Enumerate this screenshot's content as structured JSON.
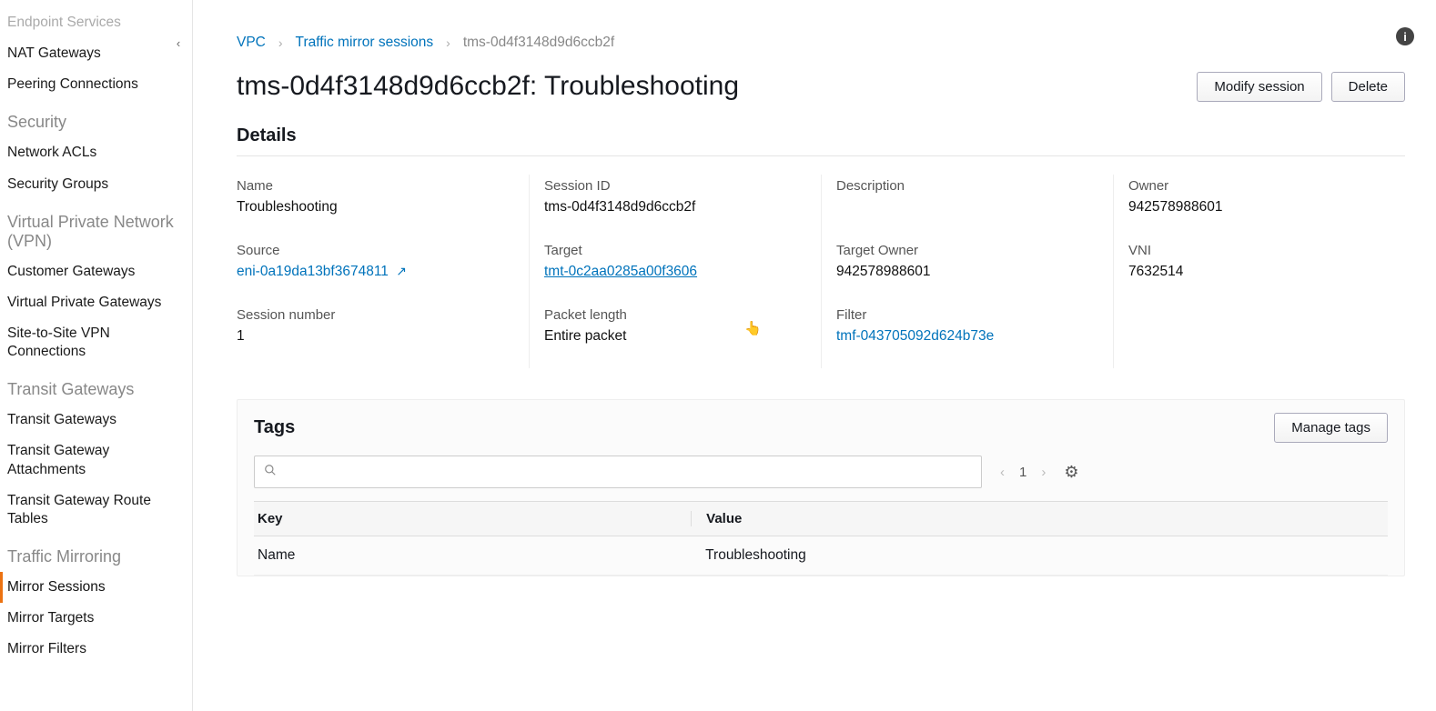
{
  "sidebar": {
    "items": [
      {
        "label": "Endpoint Services",
        "type": "item",
        "cut": true
      },
      {
        "label": "NAT Gateways",
        "type": "item"
      },
      {
        "label": "Peering Connections",
        "type": "item"
      },
      {
        "label": "Security",
        "type": "heading"
      },
      {
        "label": "Network ACLs",
        "type": "item"
      },
      {
        "label": "Security Groups",
        "type": "item"
      },
      {
        "label": "Virtual Private Network (VPN)",
        "type": "heading"
      },
      {
        "label": "Customer Gateways",
        "type": "item"
      },
      {
        "label": "Virtual Private Gateways",
        "type": "item"
      },
      {
        "label": "Site-to-Site VPN Connections",
        "type": "item"
      },
      {
        "label": "Transit Gateways",
        "type": "heading"
      },
      {
        "label": "Transit Gateways",
        "type": "item"
      },
      {
        "label": "Transit Gateway Attachments",
        "type": "item"
      },
      {
        "label": "Transit Gateway Route Tables",
        "type": "item"
      },
      {
        "label": "Traffic Mirroring",
        "type": "heading"
      },
      {
        "label": "Mirror Sessions",
        "type": "item",
        "active": true
      },
      {
        "label": "Mirror Targets",
        "type": "item"
      },
      {
        "label": "Mirror Filters",
        "type": "item"
      }
    ]
  },
  "breadcrumbs": {
    "root": "VPC",
    "mid": "Traffic mirror sessions",
    "current": "tms-0d4f3148d9d6ccb2f"
  },
  "page": {
    "title": "tms-0d4f3148d9d6ccb2f: Troubleshooting",
    "modify_label": "Modify session",
    "delete_label": "Delete"
  },
  "details": {
    "title": "Details",
    "row1": {
      "name_label": "Name",
      "name_value": "Troubleshooting",
      "session_id_label": "Session ID",
      "session_id_value": "tms-0d4f3148d9d6ccb2f",
      "description_label": "Description",
      "description_value": "",
      "owner_label": "Owner",
      "owner_value": "942578988601"
    },
    "row2": {
      "source_label": "Source",
      "source_value": "eni-0a19da13bf3674811",
      "target_label": "Target",
      "target_value": "tmt-0c2aa0285a00f3606",
      "target_owner_label": "Target Owner",
      "target_owner_value": "942578988601",
      "vni_label": "VNI",
      "vni_value": "7632514"
    },
    "row3": {
      "session_number_label": "Session number",
      "session_number_value": "1",
      "packet_length_label": "Packet length",
      "packet_length_value": "Entire packet",
      "filter_label": "Filter",
      "filter_value": "tmf-043705092d624b73e"
    }
  },
  "tags": {
    "title": "Tags",
    "manage_label": "Manage tags",
    "search_placeholder": "",
    "page_number": "1",
    "columns": {
      "key": "Key",
      "value": "Value"
    },
    "rows": [
      {
        "key": "Name",
        "value": "Troubleshooting"
      }
    ]
  },
  "icons": {
    "chevron_left": "‹",
    "chevron_right": "›",
    "external": "↗",
    "search": "🔍",
    "gear": "⚙",
    "info": "i",
    "cursor": "👆"
  }
}
